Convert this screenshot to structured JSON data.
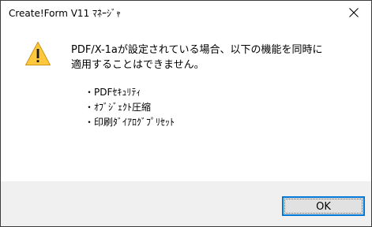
{
  "window": {
    "title": "Create!Form V11 ﾏﾈｰｼﾞｬ",
    "close_icon": "close-icon"
  },
  "message": {
    "icon": "warning-icon",
    "main_line1": "PDF/X-1aが設定されている場合、以下の機能を同時に",
    "main_line2": "適用することはできません。",
    "items": [
      "・PDFｾｷｭﾘﾃｨ",
      "・ｵﾌﾞｼﾞｪｸﾄ圧縮",
      "・印刷ﾀﾞｲｱﾛｸﾞﾌﾟﾘｾｯﾄ"
    ]
  },
  "buttons": {
    "ok_label": "OK"
  },
  "colors": {
    "accent": "#0078d7",
    "warning_fill": "#ffc83d",
    "footer_bg": "#f0f0f0"
  }
}
